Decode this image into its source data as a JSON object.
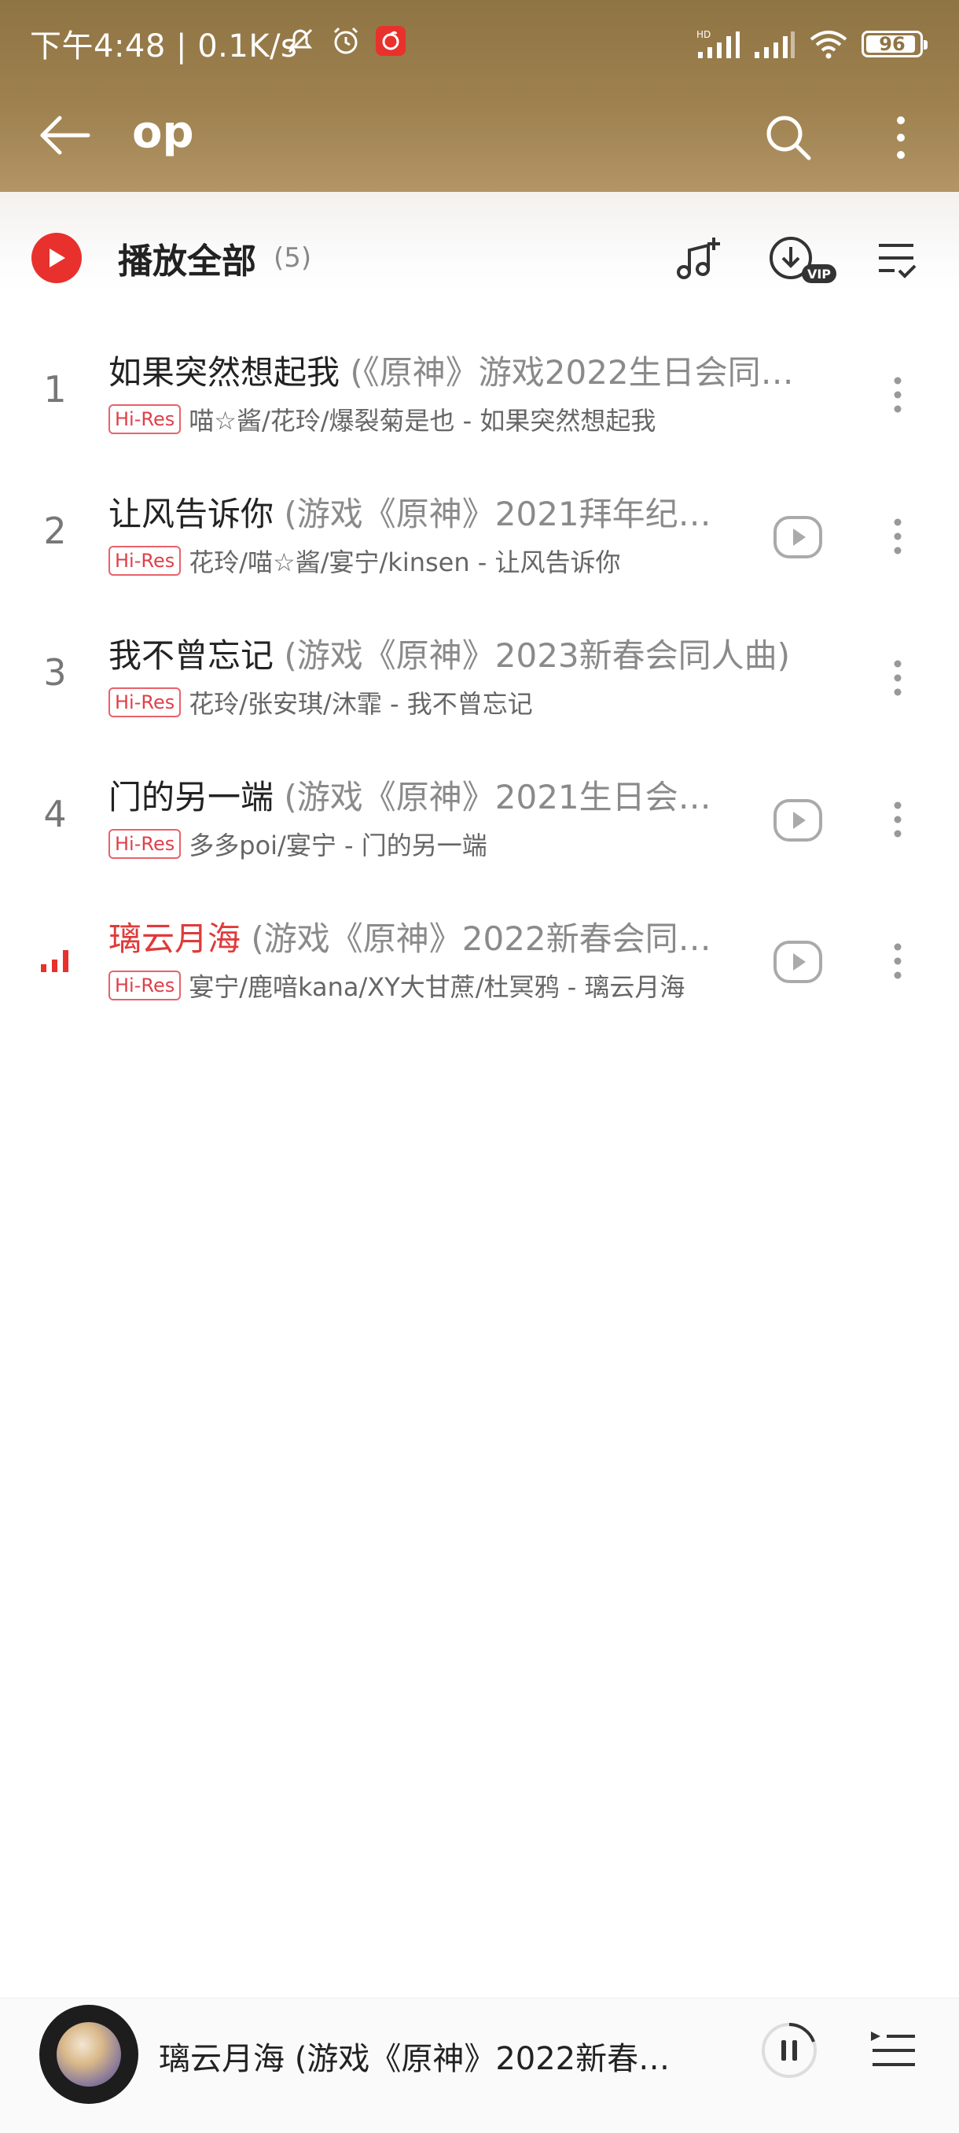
{
  "status_bar": {
    "time_speed": "下午4:48 | 0.1K/s",
    "battery": "96",
    "net_tag": "HD"
  },
  "nav": {
    "query": "op"
  },
  "toolbar": {
    "play_all_label": "播放全部",
    "count": "(5)",
    "vip_badge": "VIP"
  },
  "songs": [
    {
      "index": "1",
      "title": "如果突然想起我",
      "subtitle": " (《原神》游戏2022生日会同…",
      "tag": "Hi-Res",
      "artist_album": "喵☆酱/花玲/爆裂菊是也 - 如果突然想起我",
      "has_mv": false
    },
    {
      "index": "2",
      "title": "让风告诉你",
      "subtitle": " (游戏《原神》2021拜年纪…",
      "tag": "Hi-Res",
      "artist_album": "花玲/喵☆酱/宴宁/kinsen - 让风告诉你",
      "has_mv": true
    },
    {
      "index": "3",
      "title": "我不曾忘记",
      "subtitle": " (游戏《原神》2023新春会同人曲)",
      "tag": "Hi-Res",
      "artist_album": "花玲/张安琪/沐霏 - 我不曾忘记",
      "has_mv": false
    },
    {
      "index": "4",
      "title": "门的另一端",
      "subtitle": " (游戏《原神》2021生日会…",
      "tag": "Hi-Res",
      "artist_album": "多多poi/宴宁 - 门的另一端",
      "has_mv": true
    },
    {
      "index": "",
      "title": "璃云月海",
      "subtitle": " (游戏《原神》2022新春会同…",
      "tag": "Hi-Res",
      "artist_album": "宴宁/鹿喑kana/XY大甘蔗/杜冥鸦 - 璃云月海",
      "has_mv": true,
      "playing": true
    }
  ],
  "player": {
    "now_playing": "璃云月海 (游戏《原神》2022新春…"
  },
  "colors": {
    "accent_red": "#e8312c",
    "header_brown": "#9e814f"
  }
}
